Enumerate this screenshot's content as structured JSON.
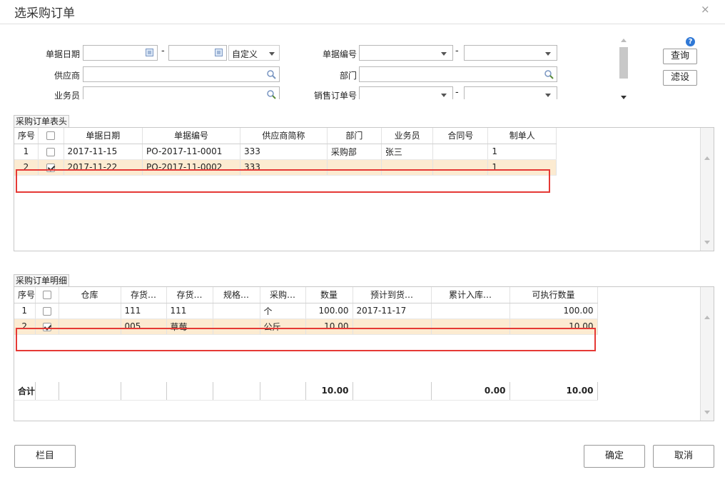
{
  "dialog": {
    "title": "选采购订单",
    "close_icon": "×"
  },
  "filters": {
    "date_label": "单据日期",
    "date_dash": "-",
    "date_mode": "自定义",
    "docno_label": "单据编号",
    "docno_dash": "-",
    "supplier_label": "供应商",
    "dept_label": "部门",
    "clerk_label": "业务员",
    "so_label": "销售订单号",
    "so_dash": "-"
  },
  "buttons": {
    "query": "查询",
    "filter": "滤设",
    "columns": "栏目",
    "ok": "确定",
    "cancel": "取消"
  },
  "header_tab": "采购订单表头",
  "header_columns": [
    "序号",
    "",
    "单据日期",
    "单据编号",
    "供应商简称",
    "部门",
    "业务员",
    "合同号",
    "制单人"
  ],
  "header_rows": [
    {
      "seq": "1",
      "checked": false,
      "date": "2017-11-15",
      "no": "PO-2017-11-0001",
      "supplier": "333",
      "dept": "采购部",
      "clerk": "张三",
      "contract": "",
      "maker": "1"
    },
    {
      "seq": "2",
      "checked": true,
      "date": "2017-11-22",
      "no": "PO-2017-11-0002",
      "supplier": "333",
      "dept": "",
      "clerk": "",
      "contract": "",
      "maker": "1"
    }
  ],
  "detail_tab": "采购订单明细",
  "detail_columns": [
    "序号",
    "",
    "仓库",
    "存货…",
    "存货…",
    "规格…",
    "采购…",
    "数量",
    "预计到货…",
    "累计入库…",
    "可执行数量"
  ],
  "detail_rows": [
    {
      "seq": "1",
      "checked": false,
      "wh": "",
      "code": "111",
      "name": "111",
      "spec": "",
      "unit": "个",
      "qty": "100.00",
      "eta": "2017-11-17",
      "inqty": "",
      "execqty": "100.00"
    },
    {
      "seq": "2",
      "checked": true,
      "wh": "",
      "code": "005",
      "name": "草莓",
      "spec": "",
      "unit": "公斤",
      "qty": "10.00",
      "eta": "",
      "inqty": "",
      "execqty": "10.00"
    }
  ],
  "total": {
    "label": "合计",
    "qty": "10.00",
    "inqty": "0.00",
    "execqty": "10.00"
  },
  "colors": {
    "highlight": "#fcebd1",
    "red_border": "#e53935"
  }
}
